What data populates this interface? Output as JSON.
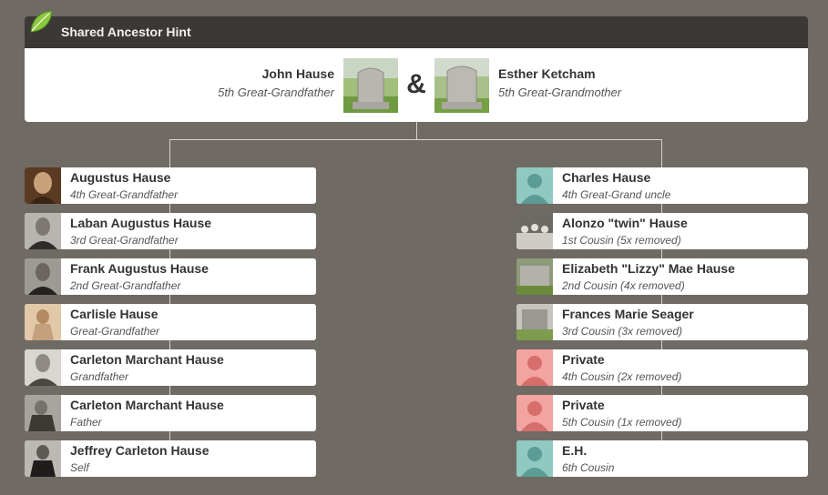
{
  "header": {
    "title": "Shared Ancestor Hint"
  },
  "couple": {
    "left": {
      "name": "John Hause",
      "relation": "5th Great-Grandfather"
    },
    "connector": "&",
    "right": {
      "name": "Esther Ketcham",
      "relation": "5th Great-Grandmother"
    }
  },
  "left_line": [
    {
      "name": "Augustus Hause",
      "relation": "4th Great-Grandfather",
      "photo": "sepia-portrait"
    },
    {
      "name": "Laban Augustus Hause",
      "relation": "3rd Great-Grandfather",
      "photo": "bw-portrait"
    },
    {
      "name": "Frank Augustus Hause",
      "relation": "2nd Great-Grandfather",
      "photo": "bw-portrait"
    },
    {
      "name": "Carlisle Hause",
      "relation": "Great-Grandfather",
      "photo": "sepia-child"
    },
    {
      "name": "Carleton Marchant Hause",
      "relation": "Grandfather",
      "photo": "bw-portrait"
    },
    {
      "name": "Carleton Marchant Hause",
      "relation": "Father",
      "photo": "bw-seated"
    },
    {
      "name": "Jeffrey Carleton Hause",
      "relation": "Self",
      "photo": "bw-child"
    }
  ],
  "right_line": [
    {
      "name": "Charles Hause",
      "relation": "4th Great-Grand uncle",
      "photo": "silhouette-teal"
    },
    {
      "name": "Alonzo \"twin\" Hause",
      "relation": "1st Cousin (5x removed)",
      "photo": "bw-group"
    },
    {
      "name": "Elizabeth \"Lizzy\" Mae Hause",
      "relation": "2nd Cousin (4x removed)",
      "photo": "gravestone"
    },
    {
      "name": "Frances Marie Seager",
      "relation": "3rd Cousin (3x removed)",
      "photo": "gravestone"
    },
    {
      "name": "Private",
      "relation": "4th Cousin (2x removed)",
      "photo": "silhouette-pink"
    },
    {
      "name": "Private",
      "relation": "5th Cousin (1x removed)",
      "photo": "silhouette-pink"
    },
    {
      "name": "E.H.",
      "relation": "6th Cousin",
      "photo": "silhouette-teal"
    }
  ],
  "colors": {
    "background": "#6f6a63",
    "header": "#3b3835",
    "teal": "#8fc9c2",
    "pink": "#f3a3a0"
  }
}
